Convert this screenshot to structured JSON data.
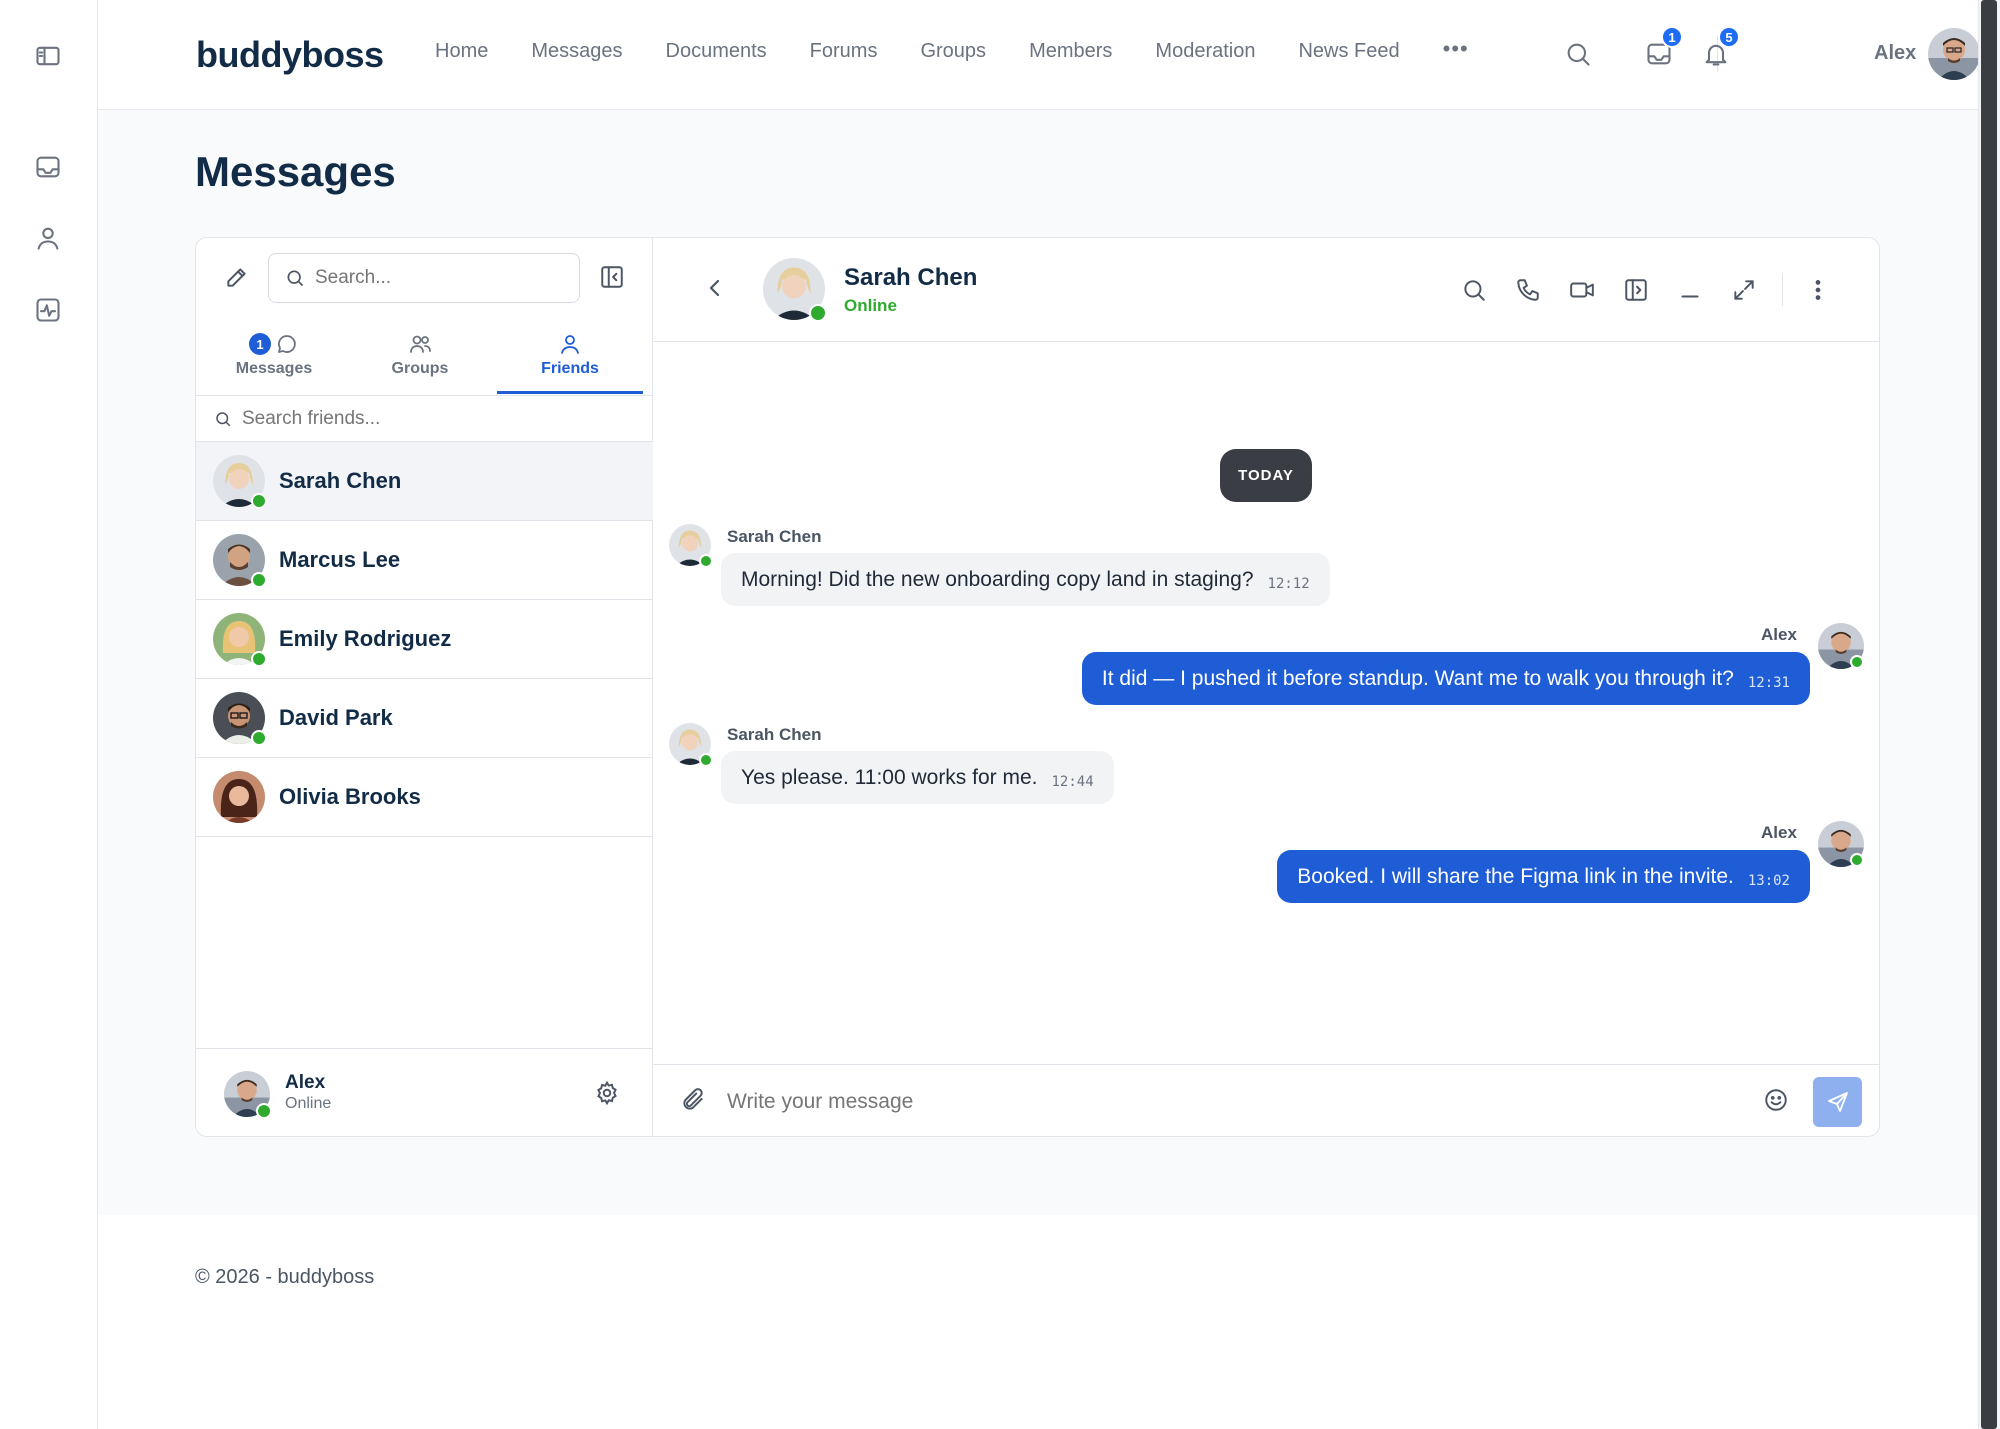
{
  "brand": "buddyboss",
  "nav": [
    "Home",
    "Messages",
    "Documents",
    "Forums",
    "Groups",
    "Members",
    "Moderation",
    "News Feed"
  ],
  "nav_more": "•••",
  "header": {
    "inbox_badge": "1",
    "notifications_badge": "5",
    "user_name": "Alex"
  },
  "page_title": "Messages",
  "sidebar": {
    "search_placeholder": "Search...",
    "tabs": [
      {
        "label": "Messages",
        "badge": "1"
      },
      {
        "label": "Groups"
      },
      {
        "label": "Friends"
      }
    ],
    "friend_search_placeholder": "Search friends...",
    "friends": [
      {
        "name": "Sarah Chen",
        "online": true
      },
      {
        "name": "Marcus Lee",
        "online": true
      },
      {
        "name": "Emily Rodriguez",
        "online": true
      },
      {
        "name": "David Park",
        "online": true
      },
      {
        "name": "Olivia Brooks",
        "online": false
      }
    ],
    "current_user": {
      "name": "Alex",
      "status": "Online"
    }
  },
  "chat": {
    "contact_name": "Sarah Chen",
    "contact_status": "Online",
    "day_label": "TODAY",
    "messages": [
      {
        "sender": "Sarah Chen",
        "text": "Morning! Did the new onboarding copy land in staging?",
        "time": "12:12",
        "direction": "in"
      },
      {
        "sender": "Alex",
        "text": "It did — I pushed it before standup. Want me to walk you through it?",
        "time": "12:31",
        "direction": "out"
      },
      {
        "sender": "Sarah Chen",
        "text": "Yes please. 11:00 works for me.",
        "time": "12:44",
        "direction": "in"
      },
      {
        "sender": "Alex",
        "text": "Booked. I will share the Figma link in the invite.",
        "time": "13:02",
        "direction": "out"
      }
    ],
    "composer_placeholder": "Write your message"
  },
  "footer": "© 2026 - buddyboss",
  "colors": {
    "accent": "#1e5dd6",
    "online": "#2eab2e",
    "badge": "#1e6cf3"
  }
}
